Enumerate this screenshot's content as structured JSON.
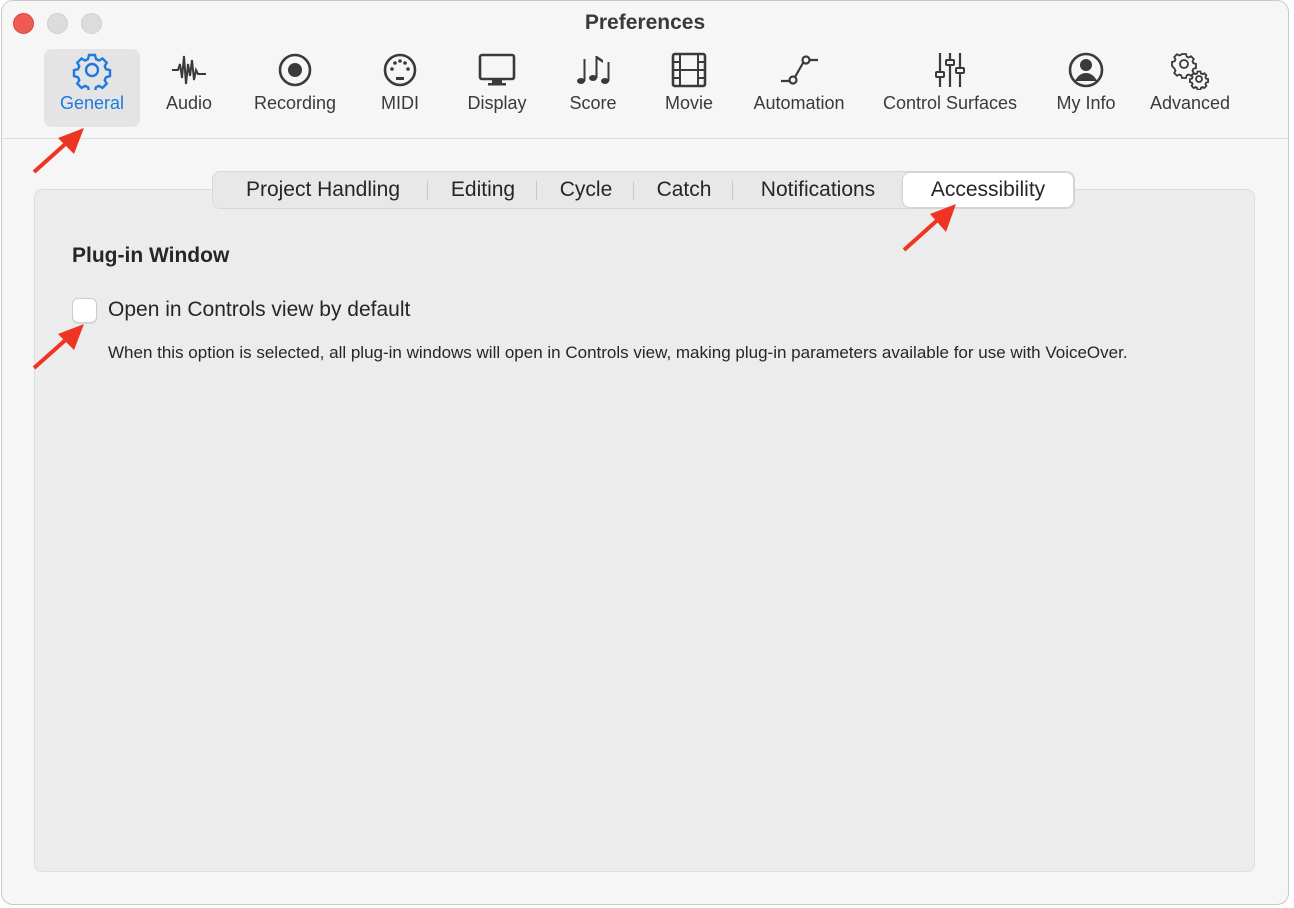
{
  "window": {
    "title": "Preferences"
  },
  "toolbar": {
    "items": [
      {
        "label": "General",
        "icon": "gear-icon",
        "selected": true
      },
      {
        "label": "Audio",
        "icon": "waveform-icon"
      },
      {
        "label": "Recording",
        "icon": "record-icon"
      },
      {
        "label": "MIDI",
        "icon": "midi-port-icon"
      },
      {
        "label": "Display",
        "icon": "display-icon"
      },
      {
        "label": "Score",
        "icon": "music-notes-icon"
      },
      {
        "label": "Movie",
        "icon": "film-icon"
      },
      {
        "label": "Automation",
        "icon": "automation-curve-icon"
      },
      {
        "label": "Control Surfaces",
        "icon": "sliders-icon"
      },
      {
        "label": "My Info",
        "icon": "person-icon"
      },
      {
        "label": "Advanced",
        "icon": "gears-icon"
      }
    ]
  },
  "tabs": {
    "items": [
      {
        "label": "Project Handling"
      },
      {
        "label": "Editing"
      },
      {
        "label": "Cycle"
      },
      {
        "label": "Catch"
      },
      {
        "label": "Notifications"
      },
      {
        "label": "Accessibility",
        "active": true
      }
    ]
  },
  "content": {
    "section_title": "Plug-in Window",
    "option_label": "Open in Controls view by default",
    "option_checked": false,
    "description": "When this option is selected, all plug-in windows will open in Controls view, making plug-in parameters available for use with VoiceOver."
  },
  "colors": {
    "accent": "#1e7ae0",
    "annotation_arrow": "#ee3524",
    "close_button": "#ee5b55"
  }
}
